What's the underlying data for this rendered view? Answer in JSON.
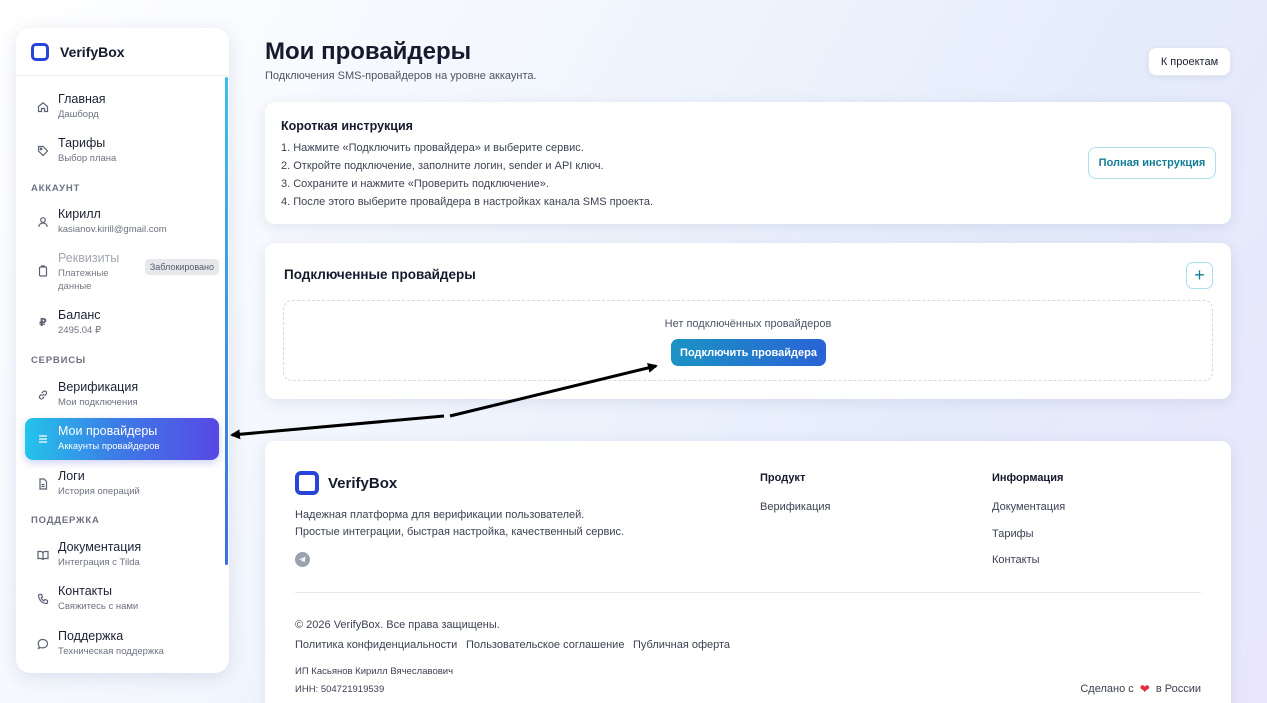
{
  "brand": {
    "name": "VerifyBox"
  },
  "sidebar": {
    "items": [
      {
        "title": "Главная",
        "subtitle": "Дашборд"
      },
      {
        "title": "Тарифы",
        "subtitle": "Выбор плана"
      },
      {
        "title": "Кирилл",
        "subtitle": "kasianov.kirill@gmail.com"
      },
      {
        "title": "Реквизиты",
        "subtitle_line1": "Платежные",
        "subtitle_line2": "данные",
        "badge": "Заблокировано"
      },
      {
        "title": "Баланс",
        "subtitle": "2495.04 ₽",
        "icon_glyph": "₽"
      },
      {
        "title": "Верификация",
        "subtitle": "Мои подключения"
      },
      {
        "title": "Мои провайдеры",
        "subtitle": "Аккаунты провайдеров"
      },
      {
        "title": "Логи",
        "subtitle": "История операций"
      },
      {
        "title": "Документация",
        "subtitle": "Интеграция с Tilda"
      },
      {
        "title": "Контакты",
        "subtitle": "Свяжитесь с нами"
      },
      {
        "title": "Поддержка",
        "subtitle": "Техническая поддержка"
      }
    ],
    "sections": {
      "account": "АККАУНТ",
      "services": "СЕРВИСЫ",
      "support": "ПОДДЕРЖКА"
    }
  },
  "header": {
    "title": "Мои провайдеры",
    "subtitle": "Подключения SMS-провайдеров на уровне аккаунта.",
    "back_button": "К проектам"
  },
  "instructions": {
    "title": "Короткая инструкция",
    "steps": [
      "1. Нажмите «Подключить провайдера» и выберите сервис.",
      "2. Откройте подключение, заполните логин, sender и API ключ.",
      "3. Сохраните и нажмите «Проверить подключение».",
      "4. После этого выберите провайдера в настройках канала SMS проекта."
    ],
    "full_button": "Полная инструкция"
  },
  "providers": {
    "title": "Подключенные провайдеры",
    "add_glyph": "+",
    "empty_text": "Нет подключённых провайдеров",
    "connect_button": "Подключить провайдера"
  },
  "footer": {
    "description_line1": "Надежная платформа для верификации пользователей.",
    "description_line2": "Простые интеграции, быстрая настройка, качественный сервис.",
    "product": {
      "heading": "Продукт",
      "links": [
        "Верификация"
      ]
    },
    "info": {
      "heading": "Информация",
      "links": [
        "Документация",
        "Тарифы",
        "Контакты"
      ]
    },
    "copyright": "© 2026 VerifyBox. Все права защищены.",
    "legal_links": [
      "Политика конфиденциальности",
      "Пользовательское соглашение",
      "Публичная оферта"
    ],
    "entity": "ИП Касьянов Кирилл Вячеславович",
    "inn": "ИНН: 504721919539",
    "made_prefix": "Сделано с",
    "made_suffix": "в России"
  },
  "colors": {
    "accent": "#2745d6",
    "active_from": "#24c4ea",
    "active_to": "#5848e4",
    "teal": "#127d96",
    "heart": "#e0303a"
  }
}
